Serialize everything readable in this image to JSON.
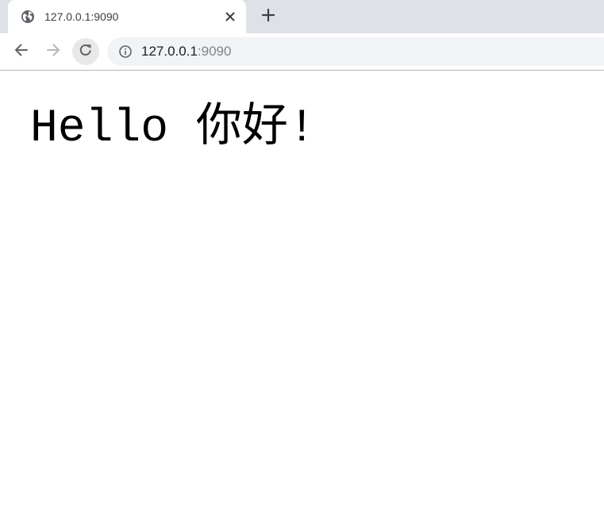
{
  "tab": {
    "title": "127.0.0.1:9090",
    "favicon": "globe-icon",
    "close_icon": "close-icon"
  },
  "new_tab": {
    "icon": "plus-icon"
  },
  "toolbar": {
    "back_icon": "arrow-left-icon",
    "forward_icon": "arrow-right-icon",
    "reload_icon": "reload-icon",
    "site_info_icon": "info-icon"
  },
  "address_bar": {
    "host": "127.0.0.1",
    "port": ":9090"
  },
  "page": {
    "heading": "Hello 你好!"
  },
  "colors": {
    "tab_strip": "#dee1e6",
    "omnibox": "#f1f3f4",
    "text": "#000000",
    "url_secondary": "#80868b"
  }
}
